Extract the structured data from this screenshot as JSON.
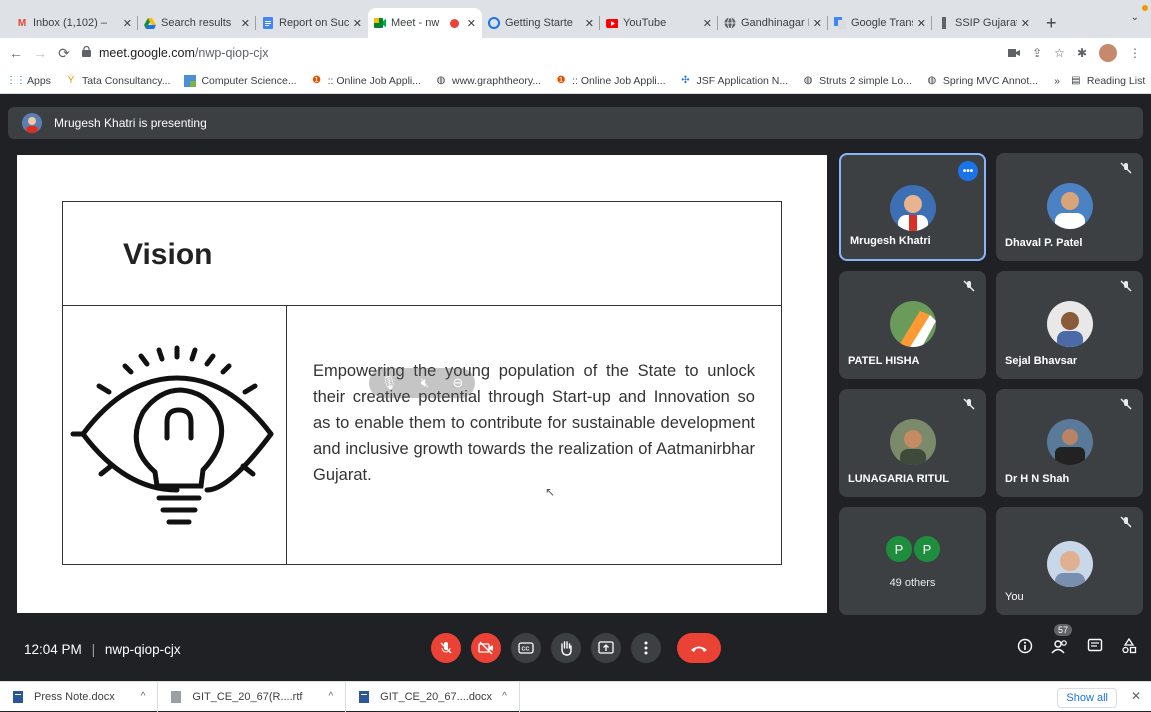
{
  "browser": {
    "tabs": [
      {
        "title": "Inbox (1,102) –",
        "icon": "gmail-icon"
      },
      {
        "title": "Search results",
        "icon": "drive-icon"
      },
      {
        "title": "Report on Suc",
        "icon": "docs-icon"
      },
      {
        "title": "Meet - nw",
        "icon": "meet-icon",
        "active": true
      },
      {
        "title": "Getting Starte",
        "icon": "getting-started-icon"
      },
      {
        "title": "YouTube",
        "icon": "youtube-icon"
      },
      {
        "title": "Gandhinagar I",
        "icon": "globe-icon"
      },
      {
        "title": "Google Transl",
        "icon": "translate-icon"
      },
      {
        "title": "SSIP Gujarat",
        "icon": "ssip-icon"
      }
    ],
    "url_domain": "meet.google.com",
    "url_path": "/nwp-qiop-cjx",
    "bookmarks": [
      {
        "label": "Apps",
        "icon": "apps-grid-icon"
      },
      {
        "label": "Tata Consultancy...",
        "icon": "tcs-icon"
      },
      {
        "label": "Computer Science...",
        "icon": "cs-icon"
      },
      {
        "label": ":: Online Job Appli...",
        "icon": "job-icon"
      },
      {
        "label": "www.graphtheory...",
        "icon": "globe-icon"
      },
      {
        "label": ":: Online Job Appli...",
        "icon": "job-icon"
      },
      {
        "label": "JSF Application N...",
        "icon": "jsf-icon"
      },
      {
        "label": "Struts 2 simple Lo...",
        "icon": "globe-icon"
      },
      {
        "label": "Spring MVC Annot...",
        "icon": "globe-icon"
      }
    ],
    "reading_list": "Reading List",
    "more_bookmarks": "»"
  },
  "meet": {
    "presenting_text": "Mrugesh Khatri is presenting",
    "slide": {
      "title": "Vision",
      "body": "Empowering the young population of the State to unlock their creative potential through Start-up and Innovation so as to enable them to contribute for sustainable development and inclusive growth towards the realization of Aatmanirbhar Gujarat."
    },
    "participants": [
      {
        "name": "Mrugesh Khatri",
        "muted": false,
        "selected": true
      },
      {
        "name": "Dhaval P. Patel",
        "muted": true
      },
      {
        "name": "PATEL HISHA",
        "muted": true
      },
      {
        "name": "Sejal Bhavsar",
        "muted": true
      },
      {
        "name": "LUNAGARIA RITUL",
        "muted": true
      },
      {
        "name": "Dr H N Shah",
        "muted": true
      },
      {
        "name": "49 others",
        "initials": [
          "P",
          "P"
        ]
      },
      {
        "name": "You",
        "muted": true
      }
    ],
    "more_dots": "•••",
    "time": "12:04 PM",
    "separator": "|",
    "meeting_code": "nwp-qiop-cjx",
    "people_count": "57",
    "accent": "#1a73e8",
    "danger": "#ea4335"
  },
  "downloads": {
    "items": [
      {
        "name": "Press Note.docx"
      },
      {
        "name": "GIT_CE_20_67(R....rtf"
      },
      {
        "name": "GIT_CE_20_67....docx"
      }
    ],
    "show_all": "Show all",
    "close": "✕"
  }
}
